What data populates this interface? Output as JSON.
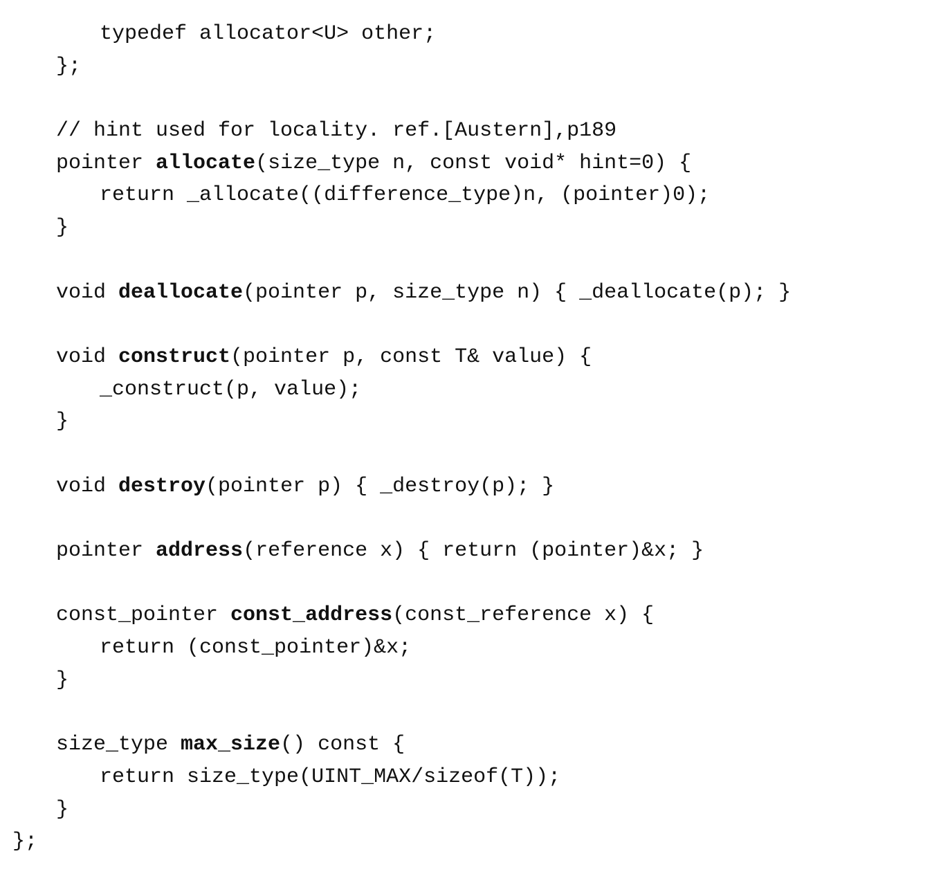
{
  "code": {
    "lines": [
      {
        "indent": 2,
        "parts": [
          "typedef allocator<U> other;"
        ]
      },
      {
        "indent": 1,
        "parts": [
          "};"
        ]
      },
      {
        "blank": true
      },
      {
        "indent": 1,
        "parts": [
          "// hint used for locality. ref.[Austern],p189"
        ]
      },
      {
        "indent": 1,
        "parts": [
          "pointer ",
          "allocate",
          "(size_type n, const void* hint=0) {"
        ],
        "bold": 1
      },
      {
        "indent": 2,
        "parts": [
          "return _allocate((difference_type)n, (pointer)0);"
        ]
      },
      {
        "indent": 1,
        "parts": [
          "}"
        ]
      },
      {
        "blank": true
      },
      {
        "indent": 1,
        "parts": [
          "void ",
          "deallocate",
          "(pointer p, size_type n) { _deallocate(p); }"
        ],
        "bold": 1
      },
      {
        "blank": true
      },
      {
        "indent": 1,
        "parts": [
          "void ",
          "construct",
          "(pointer p, const T& value) {"
        ],
        "bold": 1
      },
      {
        "indent": 2,
        "parts": [
          "_construct(p, value);"
        ]
      },
      {
        "indent": 1,
        "parts": [
          "}"
        ]
      },
      {
        "blank": true
      },
      {
        "indent": 1,
        "parts": [
          "void ",
          "destroy",
          "(pointer p) { _destroy(p); }"
        ],
        "bold": 1
      },
      {
        "blank": true
      },
      {
        "indent": 1,
        "parts": [
          "pointer ",
          "address",
          "(reference x) { return (pointer)&x; }"
        ],
        "bold": 1
      },
      {
        "blank": true
      },
      {
        "indent": 1,
        "parts": [
          "const_pointer ",
          "const_address",
          "(const_reference x) {"
        ],
        "bold": 1
      },
      {
        "indent": 2,
        "parts": [
          "return (const_pointer)&x;"
        ]
      },
      {
        "indent": 1,
        "parts": [
          "}"
        ]
      },
      {
        "blank": true
      },
      {
        "indent": 1,
        "parts": [
          "size_type ",
          "max_size",
          "() const {"
        ],
        "bold": 1
      },
      {
        "indent": 2,
        "parts": [
          "return size_type(UINT_MAX/sizeof(T));"
        ]
      },
      {
        "indent": 1,
        "parts": [
          "}"
        ]
      },
      {
        "indent": 0,
        "parts": [
          "};"
        ]
      }
    ]
  }
}
